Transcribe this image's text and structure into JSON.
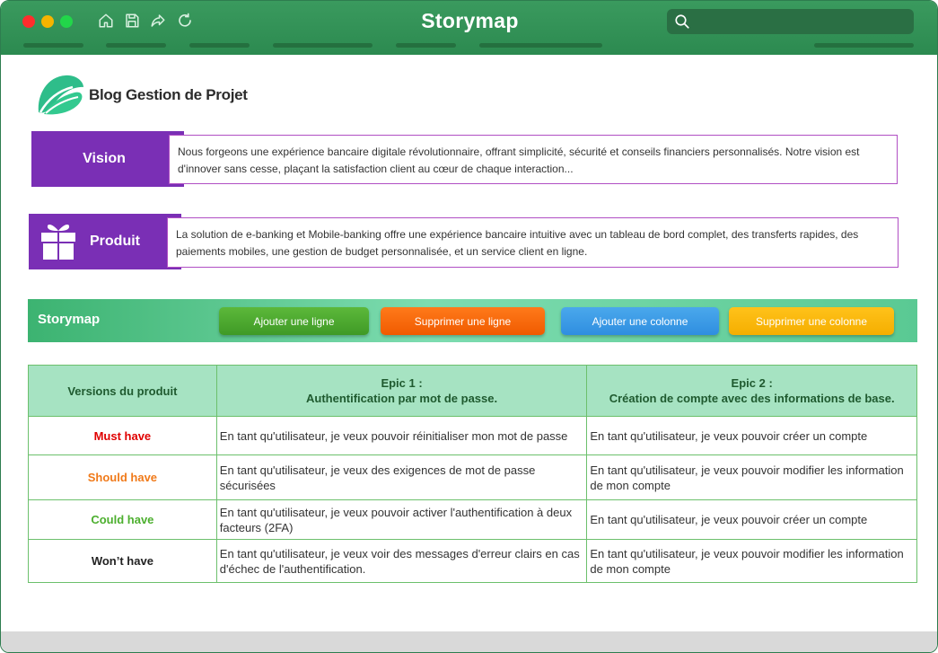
{
  "window": {
    "title": "Storymap",
    "controls": [
      "close",
      "minimize",
      "maximize"
    ],
    "toolbar_icons": [
      "home-icon",
      "save-icon",
      "share-icon",
      "refresh-icon"
    ],
    "search_placeholder": ""
  },
  "logo": {
    "text": "Blog Gestion de Projet",
    "color": "#2ebd8a"
  },
  "vision": {
    "label": "Vision",
    "text": "Nous forgeons une expérience bancaire digitale révolutionnaire, offrant simplicité, sécurité et conseils financiers personnalisés. Notre vision est d'innover sans cesse, plaçant la satisfaction client au cœur de chaque interaction..."
  },
  "produit": {
    "label": "Produit",
    "text": "La solution de e-banking et Mobile-banking offre une expérience bancaire intuitive avec un tableau de bord complet, des transferts rapides, des paiements mobiles, une gestion de budget personnalisée, et un service client en ligne."
  },
  "storymap": {
    "title": "Storymap",
    "buttons": {
      "add_row": "Ajouter une ligne",
      "delete_row": "Supprimer une ligne",
      "add_column": "Ajouter une colonne",
      "delete_column": "Supprimer une colonne"
    }
  },
  "table": {
    "headers": {
      "versions": "Versions du produit",
      "epic1_title": "Epic 1 :",
      "epic1_desc": "Authentification par mot de passe.",
      "epic2_title": "Epic 2 :",
      "epic2_desc": "Création de compte avec des informations de base."
    },
    "rows": [
      {
        "priority": "Must have",
        "color": "#e00000",
        "epic1": "En tant qu'utilisateur, je veux pouvoir réinitialiser mon mot de passe",
        "epic2": "En tant qu'utilisateur, je veux pouvoir créer un compte"
      },
      {
        "priority": "Should have",
        "color": "#f07a1a",
        "epic1": "En tant qu'utilisateur, je veux des exigences de mot de passe sécurisées",
        "epic2": "En tant qu'utilisateur, je veux pouvoir modifier les information de mon compte"
      },
      {
        "priority": "Could have",
        "color": "#4caf2e",
        "epic1": "En tant qu'utilisateur, je veux pouvoir activer l'authentification à deux facteurs (2FA)",
        "epic2": "En tant qu'utilisateur, je veux pouvoir créer un compte"
      },
      {
        "priority": "Won’t have",
        "color": "#222222",
        "epic1": "En tant qu'utilisateur, je veux voir des messages d'erreur clairs en cas d'échec de l'authentification.",
        "epic2": "En tant qu'utilisateur, je veux pouvoir modifier les information de mon compte"
      }
    ]
  }
}
